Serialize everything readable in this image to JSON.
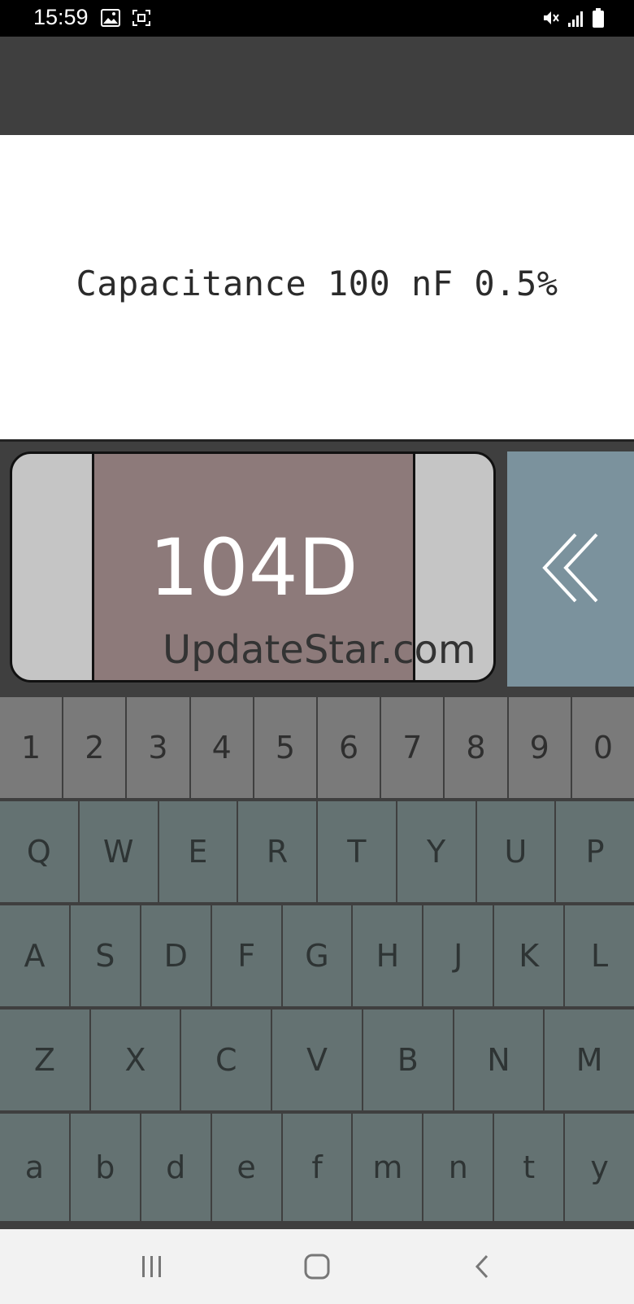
{
  "status_bar": {
    "time": "15:59"
  },
  "result": {
    "text": "Capacitance 100 nF 0.5%"
  },
  "component": {
    "code": "104D",
    "watermark": "UpdateStar.com"
  },
  "icons": {
    "backspace": "double-chevron-left-icon",
    "gallery": "image-icon",
    "screenshot": "screenshot-icon",
    "mute": "mute-icon",
    "signal": "signal-icon",
    "battery": "battery-icon",
    "recents": "recents-icon",
    "home": "home-icon",
    "back": "back-icon"
  },
  "colors": {
    "app_bar": "#3f3f3f",
    "capacitor_body": "#8d7a7a",
    "capacitor_terminal": "#c5c5c5",
    "backspace_key": "#7b929d",
    "digit_key": "#7a7a7a",
    "letter_key": "#647272"
  },
  "keyboard": {
    "rows": [
      [
        "1",
        "2",
        "3",
        "4",
        "5",
        "6",
        "7",
        "8",
        "9",
        "0"
      ],
      [
        "Q",
        "W",
        "E",
        "R",
        "T",
        "Y",
        "U",
        "P"
      ],
      [
        "A",
        "S",
        "D",
        "F",
        "G",
        "H",
        "J",
        "K",
        "L"
      ],
      [
        "Z",
        "X",
        "C",
        "V",
        "B",
        "N",
        "M"
      ],
      [
        "a",
        "b",
        "d",
        "e",
        "f",
        "m",
        "n",
        "t",
        "y"
      ]
    ]
  }
}
